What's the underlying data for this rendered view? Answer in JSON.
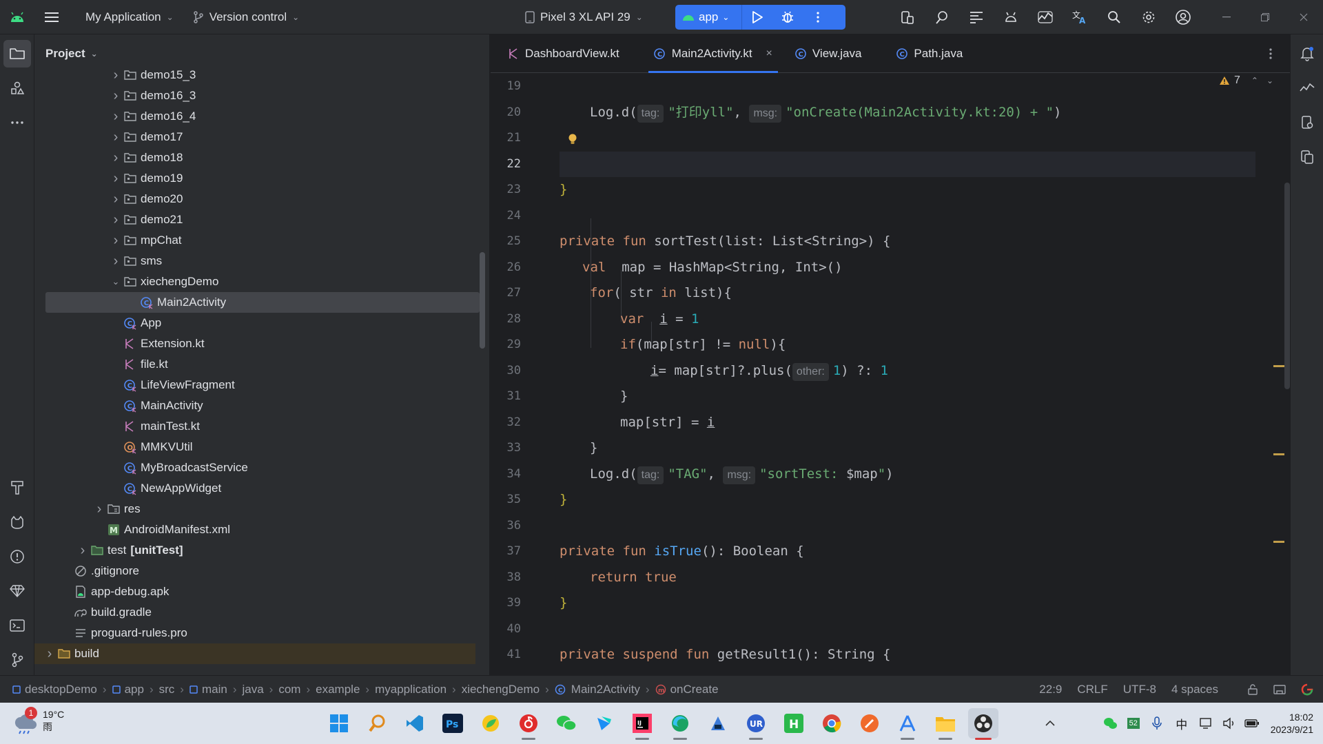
{
  "titlebar": {
    "project_name": "My Application",
    "vcs_label": "Version control",
    "device": "Pixel 3 XL API 29",
    "run_config": "app"
  },
  "project_panel": {
    "title": "Project",
    "tree": [
      {
        "label": "demo15_3",
        "type": "folder",
        "indent": 4,
        "arrow": "collapsed"
      },
      {
        "label": "demo16_3",
        "type": "folder",
        "indent": 4,
        "arrow": "collapsed"
      },
      {
        "label": "demo16_4",
        "type": "folder",
        "indent": 4,
        "arrow": "collapsed"
      },
      {
        "label": "demo17",
        "type": "folder",
        "indent": 4,
        "arrow": "collapsed"
      },
      {
        "label": "demo18",
        "type": "folder",
        "indent": 4,
        "arrow": "collapsed"
      },
      {
        "label": "demo19",
        "type": "folder",
        "indent": 4,
        "arrow": "collapsed"
      },
      {
        "label": "demo20",
        "type": "folder",
        "indent": 4,
        "arrow": "collapsed"
      },
      {
        "label": "demo21",
        "type": "folder",
        "indent": 4,
        "arrow": "collapsed"
      },
      {
        "label": "mpChat",
        "type": "folder",
        "indent": 4,
        "arrow": "collapsed"
      },
      {
        "label": "sms",
        "type": "folder",
        "indent": 4,
        "arrow": "collapsed"
      },
      {
        "label": "xiechengDemo",
        "type": "folder",
        "indent": 4,
        "arrow": "expanded"
      },
      {
        "label": "Main2Activity",
        "type": "kclass",
        "indent": 5,
        "arrow": "none",
        "selected": true
      },
      {
        "label": "App",
        "type": "kclass",
        "indent": 4,
        "arrow": "none"
      },
      {
        "label": "Extension.kt",
        "type": "kfile",
        "indent": 4,
        "arrow": "none"
      },
      {
        "label": "file.kt",
        "type": "kfile",
        "indent": 4,
        "arrow": "none"
      },
      {
        "label": "LifeViewFragment",
        "type": "kclass",
        "indent": 4,
        "arrow": "none"
      },
      {
        "label": "MainActivity",
        "type": "kclass",
        "indent": 4,
        "arrow": "none"
      },
      {
        "label": "mainTest.kt",
        "type": "kfile",
        "indent": 4,
        "arrow": "none"
      },
      {
        "label": "MMKVUtil",
        "type": "kobject",
        "indent": 4,
        "arrow": "none"
      },
      {
        "label": "MyBroadcastService",
        "type": "kclass",
        "indent": 4,
        "arrow": "none"
      },
      {
        "label": "NewAppWidget",
        "type": "kclass",
        "indent": 4,
        "arrow": "none"
      },
      {
        "label": "res",
        "type": "resfolder",
        "indent": 3,
        "arrow": "collapsed"
      },
      {
        "label": "AndroidManifest.xml",
        "type": "manifest",
        "indent": 3,
        "arrow": "none"
      },
      {
        "label": "test",
        "suffix": "[unitTest]",
        "type": "testfolder",
        "indent": 2,
        "arrow": "collapsed"
      },
      {
        "label": ".gitignore",
        "type": "ignore",
        "indent": 1,
        "arrow": "none"
      },
      {
        "label": "app-debug.apk",
        "type": "apk",
        "indent": 1,
        "arrow": "none"
      },
      {
        "label": "build.gradle",
        "type": "gradle",
        "indent": 1,
        "arrow": "none"
      },
      {
        "label": "proguard-rules.pro",
        "type": "text",
        "indent": 1,
        "arrow": "none"
      },
      {
        "label": "build",
        "type": "buildfolder",
        "indent": 0,
        "arrow": "collapsed",
        "highlight": true
      }
    ]
  },
  "editor": {
    "tabs": [
      {
        "label": "DashboardView.kt",
        "type": "kfile"
      },
      {
        "label": "Main2Activity.kt",
        "type": "kclass",
        "active": true,
        "close": "×"
      },
      {
        "label": "View.java",
        "type": "jclass"
      },
      {
        "label": "Path.java",
        "type": "jclass"
      }
    ],
    "warning_count": "7",
    "current_line": 22,
    "line_numbers": [
      19,
      20,
      21,
      22,
      23,
      24,
      25,
      26,
      27,
      28,
      29,
      30,
      31,
      32,
      33,
      34,
      35,
      36,
      37,
      38,
      39,
      40,
      41
    ],
    "code": {
      "l20": {
        "call": "Log.d(",
        "hint_tag": "tag:",
        "tag": "\"打印yll\"",
        "comma": ",",
        "hint_msg": "msg:",
        "msg": "\"onCreate(Main2Activity.kt:20) + \"",
        "close": ")"
      },
      "l23": "}",
      "l25": {
        "kw": "private fun",
        "name": "sortTest",
        "params": "(list: List<String>) {"
      },
      "l26": {
        "kw": "val",
        "rest": "map = HashMap<String, Int>()"
      },
      "l27": {
        "kw": "for",
        "rest1": "( str ",
        "kw2": "in",
        "rest2": " list){"
      },
      "l28": {
        "kw": "var",
        "var": "i",
        "rest": " = ",
        "num": "1"
      },
      "l29": {
        "kw": "if",
        "rest1": "(map[str] != ",
        "kw2": "null",
        "rest2": "){"
      },
      "l30": {
        "var": "i",
        "rest": "= map[str]?.plus(",
        "hint": "other:",
        "num": "1",
        "rest2": ") ?: ",
        "num2": "1"
      },
      "l31": "}",
      "l32": {
        "rest": "map[str] = ",
        "var": "i"
      },
      "l33": "}",
      "l34": {
        "call": "Log.d(",
        "hint_tag": "tag:",
        "tag": "\"TAG\"",
        "comma": ",",
        "hint_msg": "msg:",
        "msg_pre": "\"sortTest: ",
        "msg_var": "$map",
        "msg_post": "\"",
        "close": ")"
      },
      "l35": "}",
      "l37": {
        "kw": "private fun",
        "name": "isTrue",
        "rest": "(): Boolean {"
      },
      "l38": {
        "kw": "return",
        "kw2": "true"
      },
      "l39": "}",
      "l41": {
        "kw": "private suspend fun",
        "name": "getResult1",
        "rest": "(): String {"
      }
    }
  },
  "statusbar": {
    "breadcrumbs": [
      {
        "label": "desktopDemo",
        "icon": "module"
      },
      {
        "label": "app",
        "icon": "module"
      },
      {
        "label": "src"
      },
      {
        "label": "main",
        "icon": "module"
      },
      {
        "label": "java"
      },
      {
        "label": "com"
      },
      {
        "label": "example"
      },
      {
        "label": "myapplication"
      },
      {
        "label": "xiechengDemo"
      },
      {
        "label": "Main2Activity",
        "icon": "kclass"
      },
      {
        "label": "onCreate",
        "icon": "method"
      }
    ],
    "position": "22:9",
    "line_ending": "CRLF",
    "encoding": "UTF-8",
    "indent": "4 spaces"
  },
  "taskbar": {
    "weather_temp": "19°C",
    "weather_desc": "雨",
    "weather_badge": "1",
    "ime": "中",
    "tray_badge": "52",
    "time": "18:02",
    "date": "2023/9/21"
  },
  "colors": {
    "accent": "#3574f0",
    "keyword": "#cf8e6d",
    "string": "#6aab73",
    "number": "#2aacb8",
    "function": "#56a8f5",
    "warning": "#c29e4a"
  }
}
